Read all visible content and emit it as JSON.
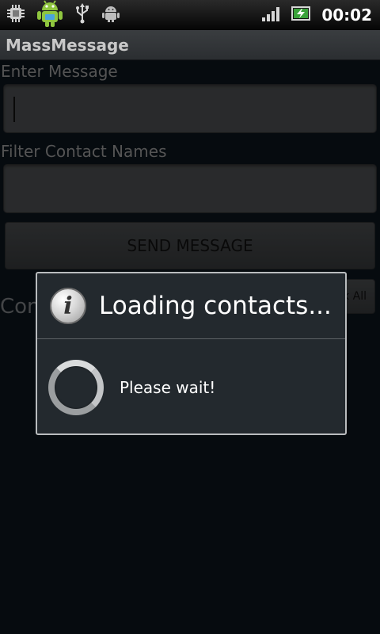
{
  "status_bar": {
    "time": "00:02",
    "icons": [
      "cpu-icon",
      "android-debug-icon",
      "usb-icon",
      "android-icon",
      "signal-icon",
      "battery-charging-icon"
    ]
  },
  "app": {
    "title": "MassMessage"
  },
  "form": {
    "message_label": "Enter Message",
    "message_value": "",
    "filter_label": "Filter Contact Names",
    "filter_value": "",
    "send_button": "SEND MESSAGE",
    "contacts_label": "Con",
    "check_all_button": "k All"
  },
  "dialog": {
    "title": "Loading contacts...",
    "message": "Please wait!"
  },
  "colors": {
    "background": "#0b141c",
    "dialog_bg": "#23292e",
    "dialog_border": "#b9bcbe"
  }
}
